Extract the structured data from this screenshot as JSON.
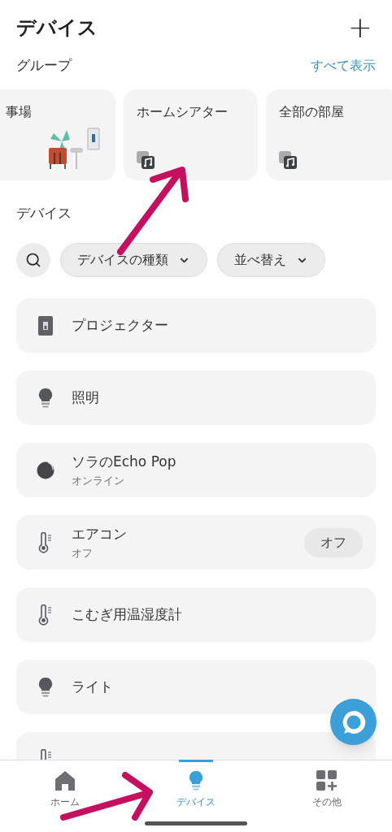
{
  "header": {
    "title": "デバイス",
    "add_label": "+"
  },
  "groups_section": {
    "title": "グループ",
    "see_all": "すべて表示"
  },
  "groups": [
    {
      "name": "事場",
      "kind": "illustration"
    },
    {
      "name": "ホームシアター",
      "kind": "music"
    },
    {
      "name": "全部の部屋",
      "kind": "music"
    }
  ],
  "devices_section": {
    "title": "デバイス"
  },
  "filters": [
    {
      "label": "デバイスの種類"
    },
    {
      "label": "並べ替え"
    }
  ],
  "devices": [
    {
      "name": "プロジェクター",
      "kind": "switch"
    },
    {
      "name": "照明",
      "kind": "bulb"
    },
    {
      "name": "ソラのEcho Pop",
      "kind": "echo",
      "status": "オンライン"
    },
    {
      "name": "エアコン",
      "kind": "thermometer",
      "status": "オフ",
      "action": "オフ"
    },
    {
      "name": "こむぎ用温湿度計",
      "kind": "thermometer"
    },
    {
      "name": "ライト",
      "kind": "bulb"
    },
    {
      "kind": "thermometer"
    }
  ],
  "nav": [
    {
      "label": "ホーム",
      "kind": "home",
      "selected": false
    },
    {
      "label": "デバイス",
      "kind": "bulb",
      "selected": true
    },
    {
      "label": "その他",
      "kind": "more",
      "selected": false
    }
  ]
}
